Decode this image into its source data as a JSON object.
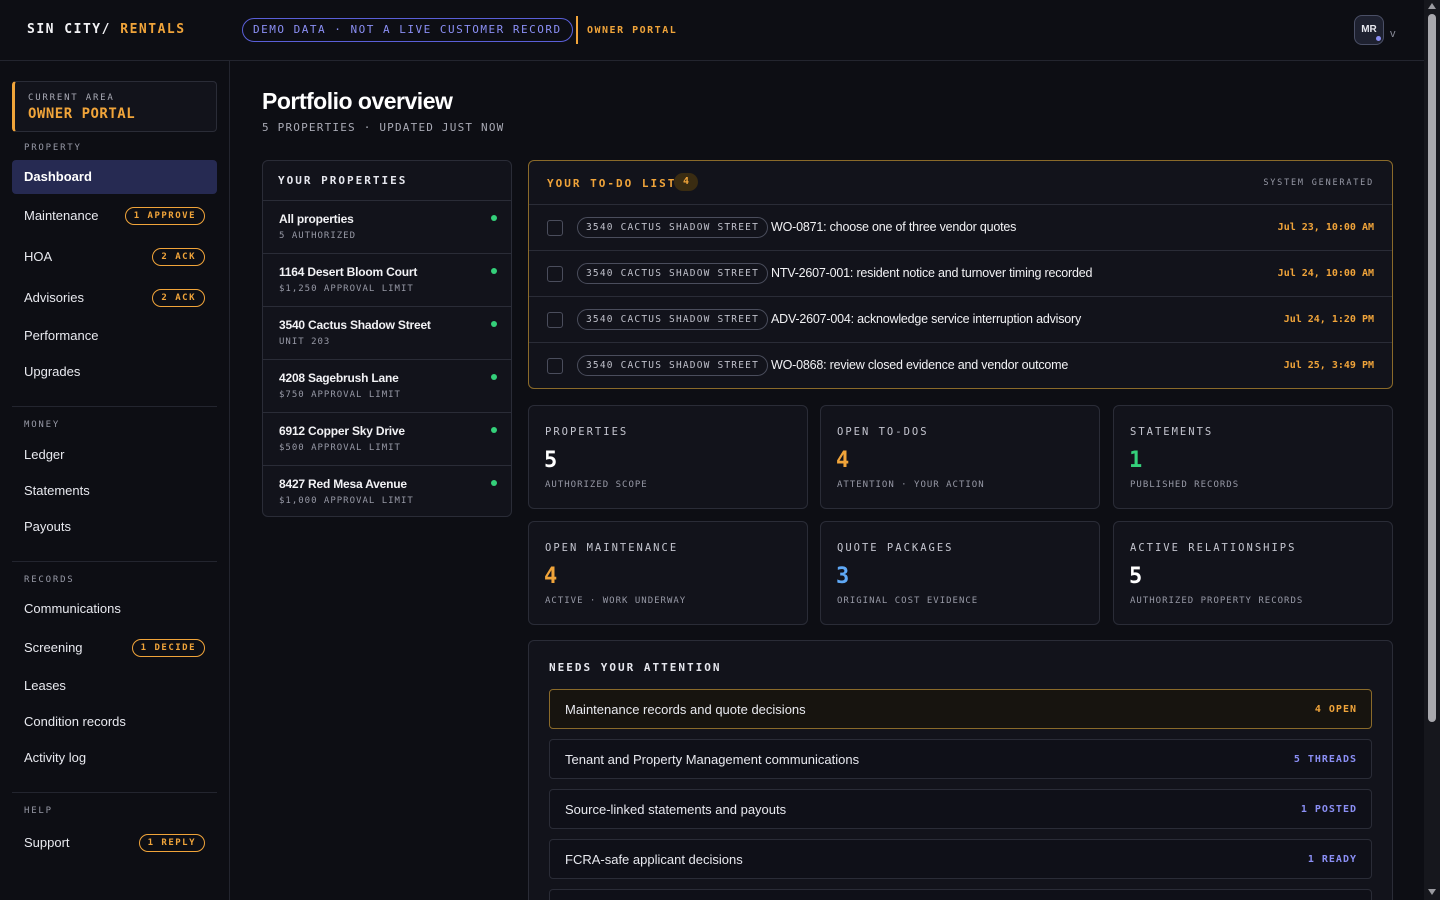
{
  "brand": {
    "part1": "SIN CITY/",
    "part2": " RENTALS"
  },
  "header": {
    "demo_badge": "DEMO DATA · NOT A LIVE CUSTOMER RECORD",
    "portal_tag": "OWNER PORTAL",
    "avatar_initials": "MR",
    "menu_chevron": "v"
  },
  "sidebar": {
    "current_area_label": "CURRENT AREA",
    "current_area_value": "OWNER PORTAL",
    "sections": [
      {
        "label": "PROPERTY",
        "items": [
          {
            "label": "Dashboard",
            "active": true
          },
          {
            "label": "Maintenance",
            "badge": "1 APPROVE"
          },
          {
            "label": "HOA",
            "badge": "2 ACK"
          },
          {
            "label": "Advisories",
            "badge": "2 ACK"
          },
          {
            "label": "Performance"
          },
          {
            "label": "Upgrades"
          }
        ]
      },
      {
        "label": "MONEY",
        "items": [
          {
            "label": "Ledger"
          },
          {
            "label": "Statements"
          },
          {
            "label": "Payouts"
          }
        ]
      },
      {
        "label": "RECORDS",
        "items": [
          {
            "label": "Communications"
          },
          {
            "label": "Screening",
            "badge": "1 DECIDE"
          },
          {
            "label": "Leases"
          },
          {
            "label": "Condition records"
          },
          {
            "label": "Activity log"
          }
        ]
      },
      {
        "label": "HELP",
        "items": [
          {
            "label": "Support",
            "badge": "1 REPLY"
          }
        ]
      }
    ]
  },
  "main": {
    "title": "Portfolio overview",
    "subtitle": "5 PROPERTIES · UPDATED JUST NOW",
    "properties_panel": {
      "title": "YOUR PROPERTIES",
      "items": [
        {
          "name": "All properties",
          "meta": "5 AUTHORIZED"
        },
        {
          "name": "1164 Desert Bloom Court",
          "meta": "$1,250 APPROVAL LIMIT"
        },
        {
          "name": "3540 Cactus Shadow Street",
          "meta": "UNIT 203"
        },
        {
          "name": "4208 Sagebrush Lane",
          "meta": "$750 APPROVAL LIMIT"
        },
        {
          "name": "6912 Copper Sky Drive",
          "meta": "$500 APPROVAL LIMIT"
        },
        {
          "name": "8427 Red Mesa Avenue",
          "meta": "$1,000 APPROVAL LIMIT"
        }
      ]
    },
    "todo": {
      "title": "YOUR TO-DO LIST",
      "count": "4",
      "system_label": "SYSTEM GENERATED",
      "items": [
        {
          "address": "3540 CACTUS SHADOW STREET",
          "text": "WO-0871: choose one of three vendor quotes",
          "date": "Jul 23, 10:00 AM"
        },
        {
          "address": "3540 CACTUS SHADOW STREET",
          "text": "NTV-2607-001: resident notice and turnover timing recorded",
          "date": "Jul 24, 10:00 AM"
        },
        {
          "address": "3540 CACTUS SHADOW STREET",
          "text": "ADV-2607-004: acknowledge service interruption advisory",
          "date": "Jul 24, 1:20 PM"
        },
        {
          "address": "3540 CACTUS SHADOW STREET",
          "text": "WO-0868: review closed evidence and vendor outcome",
          "date": "Jul 25, 3:49 PM"
        }
      ]
    },
    "stats": [
      {
        "label": "PROPERTIES",
        "value": "5",
        "sub": "AUTHORIZED SCOPE",
        "color": "#ffffff"
      },
      {
        "label": "OPEN TO-DOS",
        "value": "4",
        "sub": "ATTENTION · YOUR ACTION",
        "color": "#f0a43a"
      },
      {
        "label": "STATEMENTS",
        "value": "1",
        "sub": "PUBLISHED RECORDS",
        "color": "#34d07a"
      },
      {
        "label": "OPEN MAINTENANCE",
        "value": "4",
        "sub": "ACTIVE · WORK UNDERWAY",
        "color": "#f0a43a"
      },
      {
        "label": "QUOTE PACKAGES",
        "value": "3",
        "sub": "ORIGINAL COST EVIDENCE",
        "color": "#5fa8f5"
      },
      {
        "label": "ACTIVE RELATIONSHIPS",
        "value": "5",
        "sub": "AUTHORIZED PROPERTY RECORDS",
        "color": "#ffffff"
      }
    ],
    "attention": {
      "title": "NEEDS YOUR ATTENTION",
      "items": [
        {
          "text": "Maintenance records and quote decisions",
          "count": "4 OPEN",
          "color": "#f0a43a"
        },
        {
          "text": "Tenant and Property Management communications",
          "count": "5 THREADS",
          "color": "#8b8ff5"
        },
        {
          "text": "Source-linked statements and payouts",
          "count": "1 POSTED",
          "color": "#8b8ff5"
        },
        {
          "text": "FCRA-safe applicant decisions",
          "count": "1 READY",
          "color": "#8b8ff5"
        }
      ]
    }
  }
}
